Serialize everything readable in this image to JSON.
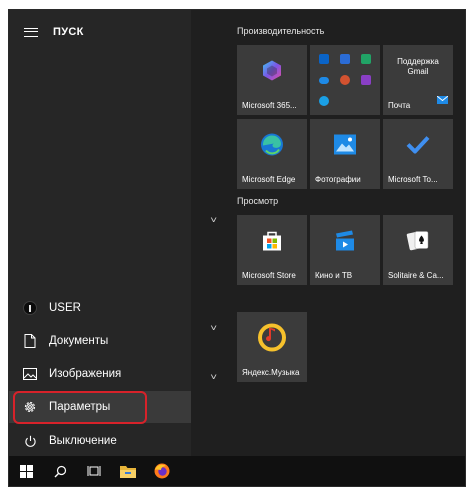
{
  "start": {
    "title": "ПУСК"
  },
  "left_nav": {
    "user": "USER",
    "documents": "Документы",
    "pictures": "Изображения",
    "settings": "Параметры",
    "power": "Выключение"
  },
  "groups": {
    "productivity": "Производительность",
    "explore": "Просмотр"
  },
  "tiles": {
    "office": "Microsoft 365...",
    "gmail_line1": "Поддержка",
    "gmail_line2": "Gmail",
    "mail": "Почта",
    "edge": "Microsoft Edge",
    "photos": "Фотографии",
    "todo": "Microsoft To...",
    "store": "Microsoft Store",
    "movies": "Кино и ТВ",
    "solitaire": "Solitaire & Ca...",
    "yandex_music": "Яндекс.Музыка"
  },
  "colors": {
    "highlight": "#d7222a",
    "accent_blue": "#1e8ae6",
    "tile_bg": "#3b3b3b",
    "yandex_yellow": "#f6c12c"
  },
  "icons": [
    "hamburger-icon",
    "user-avatar-icon",
    "document-icon",
    "pictures-icon",
    "gear-icon",
    "power-icon",
    "windows-logo-icon",
    "search-icon",
    "task-view-icon",
    "file-explorer-icon",
    "firefox-icon"
  ]
}
